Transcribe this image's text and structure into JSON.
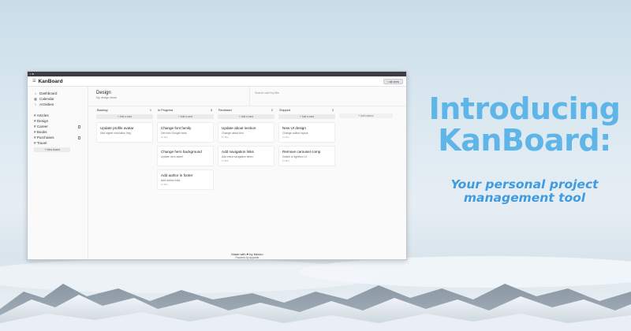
{
  "app": {
    "title": "KanBoard",
    "window_dots": "• ●",
    "user_button": "• all ones"
  },
  "sidebar": {
    "nav": [
      {
        "label": "Dashboard",
        "icon": "home-icon"
      },
      {
        "label": "Calendar",
        "icon": "calendar-icon"
      },
      {
        "label": "Activities",
        "icon": "activity-icon"
      }
    ],
    "boards": [
      {
        "label": "# Articles",
        "trash": false
      },
      {
        "label": "# Design",
        "trash": false
      },
      {
        "label": "# Career",
        "trash": true
      },
      {
        "label": "# Books",
        "trash": false
      },
      {
        "label": "# Purchases",
        "trash": true
      },
      {
        "label": "# Travel",
        "trash": false
      }
    ],
    "new_board": "+ New board"
  },
  "main": {
    "title": "Design",
    "subtitle": "My design ideas",
    "search_placeholder": "Search card by title"
  },
  "columns": [
    {
      "name": "Backlog",
      "count": "1",
      "add": "+ Add a card",
      "cards": [
        {
          "title": "Update profile avatar",
          "desc": "Add higher resolution img",
          "meta": ""
        }
      ]
    },
    {
      "name": "In Progress",
      "count": "3",
      "add": "+ Add a card",
      "cards": [
        {
          "title": "Change font family",
          "desc": "Get new Google fonts",
          "meta": "12 Mar"
        },
        {
          "title": "Change hero background",
          "desc": "Update hero asset",
          "meta": ""
        },
        {
          "title": "Add author in footer",
          "desc": "Add author links",
          "meta": "14 Mar"
        }
      ]
    },
    {
      "name": "Reviewed",
      "count": "2",
      "add": "+ Add a card",
      "cards": [
        {
          "title": "Update about section",
          "desc": "Change about text",
          "meta": "12 Mar"
        },
        {
          "title": "Add navigation links",
          "desc": "Add extra navigation items",
          "meta": "12 Mar"
        }
      ]
    },
    {
      "name": "Shipped",
      "count": "2",
      "add": "+ Add a card",
      "cards": [
        {
          "title": "New UI design",
          "desc": "Change author layout",
          "meta": "11 Mar"
        },
        {
          "title": "Remove carousel comp",
          "desc": "Switch to lightbox UI",
          "meta": "12 Mar"
        }
      ]
    }
  ],
  "add_column": "+ Add column",
  "footer": {
    "made_with": "Made with ♥ by Medzo",
    "powered_by": "Powered by Appwrite"
  },
  "promo": {
    "headline_line1": "Introducing",
    "headline_line2": "KanBoard:",
    "tagline": "Your personal project management tool"
  },
  "colors": {
    "headline": "#5fb4e8",
    "tagline": "#3f9be0",
    "sky_top": "#c9dde9"
  }
}
